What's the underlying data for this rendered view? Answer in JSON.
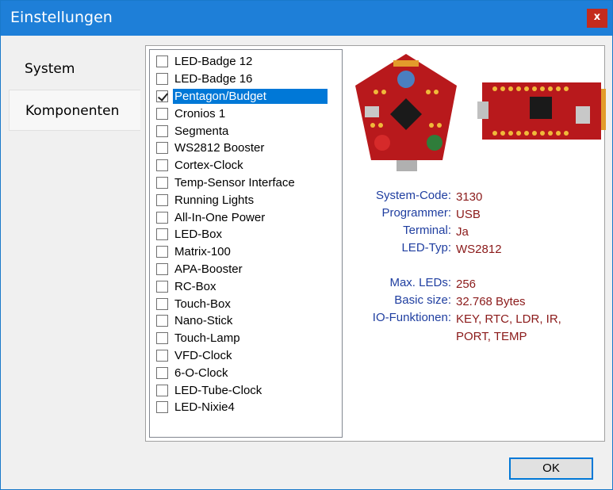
{
  "window": {
    "title": "Einstellungen",
    "close_glyph": "x"
  },
  "tabs": [
    {
      "label": "System"
    },
    {
      "label": "Komponenten"
    }
  ],
  "components": [
    {
      "label": "LED-Badge 12",
      "checked": false
    },
    {
      "label": "LED-Badge 16",
      "checked": false
    },
    {
      "label": "Pentagon/Budget",
      "checked": true,
      "selected": true
    },
    {
      "label": "Cronios 1",
      "checked": false
    },
    {
      "label": "Segmenta",
      "checked": false
    },
    {
      "label": "WS2812 Booster",
      "checked": false
    },
    {
      "label": "Cortex-Clock",
      "checked": false
    },
    {
      "label": "Temp-Sensor Interface",
      "checked": false
    },
    {
      "label": "Running Lights",
      "checked": false
    },
    {
      "label": "All-In-One Power",
      "checked": false
    },
    {
      "label": "LED-Box",
      "checked": false
    },
    {
      "label": "Matrix-100",
      "checked": false
    },
    {
      "label": "APA-Booster",
      "checked": false
    },
    {
      "label": "RC-Box",
      "checked": false
    },
    {
      "label": "Touch-Box",
      "checked": false
    },
    {
      "label": "Nano-Stick",
      "checked": false
    },
    {
      "label": "Touch-Lamp",
      "checked": false
    },
    {
      "label": "VFD-Clock",
      "checked": false
    },
    {
      "label": "6-O-Clock",
      "checked": false
    },
    {
      "label": "LED-Tube-Clock",
      "checked": false
    },
    {
      "label": "LED-Nixie4",
      "checked": false
    }
  ],
  "info": [
    {
      "key": "System-Code:",
      "value": "3130"
    },
    {
      "key": "Programmer:",
      "value": "USB"
    },
    {
      "key": "Terminal:",
      "value": "Ja"
    },
    {
      "key": "LED-Typ:",
      "value": "WS2812"
    },
    {
      "key": "Max. LEDs:",
      "value": "256"
    },
    {
      "key": "Basic size:",
      "value": "32.768 Bytes"
    },
    {
      "key": "IO-Funktionen:",
      "value": "KEY, RTC, LDR, IR,\nPORT, TEMP"
    }
  ],
  "buttons": {
    "ok": "OK"
  },
  "colors": {
    "titlebar": "#1e7fd8",
    "selection": "#0078d7",
    "key_text": "#1f3ea0",
    "value_text": "#8b1a1a"
  }
}
